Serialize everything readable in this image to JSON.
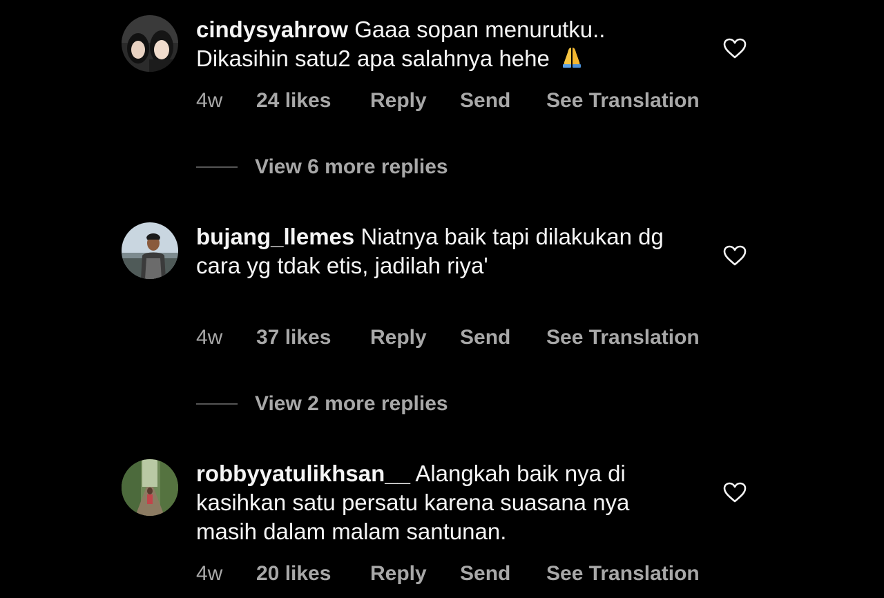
{
  "comments": [
    {
      "username": "cindysyahrow",
      "text": "Gaaa sopan menurutku.. Dikasihin satu2 apa salahnya hehe",
      "emoji": "folded-hands",
      "age": "4w",
      "likes": "24 likes",
      "reply_label": "Reply",
      "send_label": "Send",
      "translate_label": "See Translation",
      "view_replies": "View 6 more replies"
    },
    {
      "username": "bujang_llemes",
      "text": "Niatnya baik tapi dilakukan dg cara yg tdak etis, jadilah riya'",
      "age": "4w",
      "likes": "37 likes",
      "reply_label": "Reply",
      "send_label": "Send",
      "translate_label": "See Translation",
      "view_replies": "View 2 more replies"
    },
    {
      "username": "robbyyatulikhsan__",
      "text": "Alangkah baik nya di kasihkan satu persatu karena suasana nya masih dalam malam santunan.",
      "age": "4w",
      "likes": "20 likes",
      "reply_label": "Reply",
      "send_label": "Send",
      "translate_label": "See Translation"
    }
  ],
  "colors": {
    "background": "#000000",
    "primary_text": "#f5f5f5",
    "secondary_text": "#a8a8a8"
  }
}
